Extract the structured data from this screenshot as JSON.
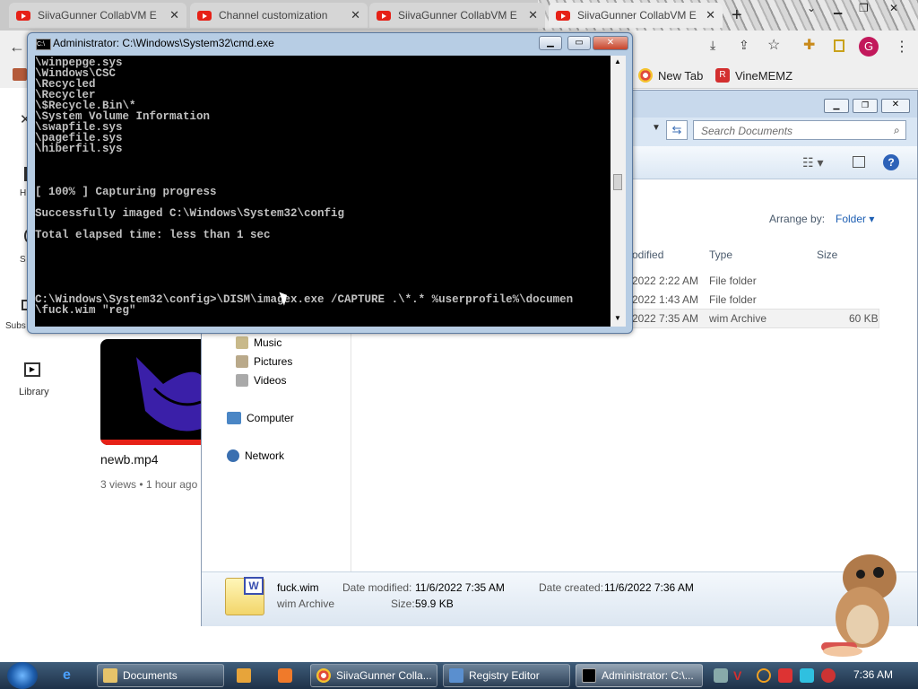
{
  "chrome": {
    "tabs": [
      {
        "label": "SiivaGunner CollabVM E"
      },
      {
        "label": "Channel customization"
      },
      {
        "label": "SiivaGunner CollabVM E"
      },
      {
        "label": "SiivaGunner CollabVM E"
      }
    ],
    "profile_letter": "G",
    "bookmarks": [
      {
        "label": "New Tab"
      },
      {
        "label": "VineMEMZ"
      }
    ]
  },
  "youtube": {
    "nav": [
      "H",
      "S",
      "Subs",
      "Library"
    ],
    "video": {
      "title": "newb.mp4",
      "meta": "3 views • 1 hour ago"
    }
  },
  "cmd": {
    "title": "Administrator: C:\\Windows\\System32\\cmd.exe",
    "console_text": "\\winpepge.sys\n\\Windows\\CSC\n\\Recycled\n\\Recycler\n\\$Recycle.Bin\\*\n\\System Volume Information\n\\swapfile.sys\n\\pagefile.sys\n\\hiberfil.sys\n\n\n\n[ 100% ] Capturing progress\n\nSuccessfully imaged C:\\Windows\\System32\\config\n\nTotal elapsed time: less than 1 sec\n\n\n\n\n\nC:\\Windows\\System32\\config>\\DISM\\imagex.exe /CAPTURE .\\*.* %userprofile%\\documen\n\\fuck.wim \"reg\""
  },
  "explorer": {
    "search_placeholder": "Search Documents",
    "arrange_label": "Arrange by:",
    "arrange_value": "Folder",
    "columns": [
      "odified",
      "Type",
      "Size"
    ],
    "rows": [
      {
        "modified": "2022 2:22 AM",
        "type": "File folder",
        "size": ""
      },
      {
        "modified": "2022 1:43 AM",
        "type": "File folder",
        "size": ""
      },
      {
        "modified": "2022 7:35 AM",
        "type": "wim Archive",
        "size": "60 KB"
      }
    ],
    "nav": [
      "Music",
      "Pictures",
      "Videos",
      "Computer",
      "Network"
    ],
    "details": {
      "name": "fuck.wim",
      "type": "wim Archive",
      "modified_label": "Date modified:",
      "modified_value": "11/6/2022 7:35 AM",
      "created_label": "Date created:",
      "created_value": "11/6/2022 7:36 AM",
      "size_label": "Size:",
      "size_value": "59.9 KB"
    }
  },
  "taskbar": {
    "items": [
      {
        "label": "Documents"
      },
      {
        "label": "SiivaGunner Colla..."
      },
      {
        "label": "Registry Editor"
      },
      {
        "label": "Administrator: C:\\..."
      }
    ],
    "clock": "7:36 AM"
  }
}
